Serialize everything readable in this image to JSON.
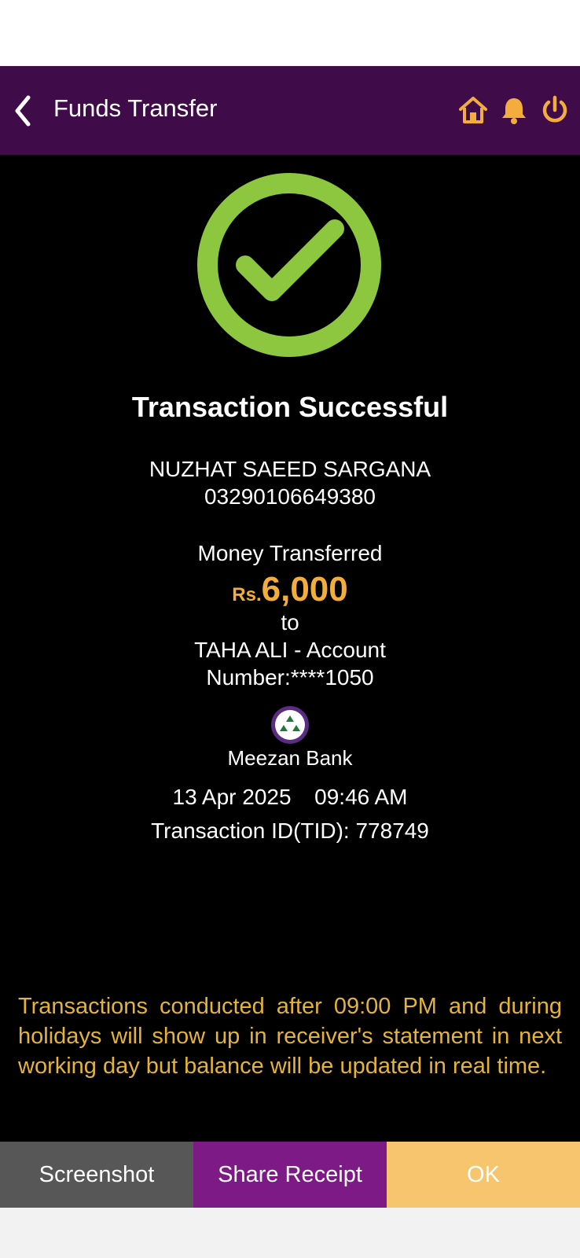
{
  "header": {
    "title": "Funds Transfer",
    "icons": [
      "back-arrow-icon",
      "home-icon",
      "bell-icon",
      "power-icon"
    ],
    "accent_color": "#f2ad3c",
    "background_color": "#3f0b49"
  },
  "receipt": {
    "status_icon": "check-circle-icon",
    "status_color": "#8dc63f",
    "status": "Transaction Successful",
    "sender_name": "NUZHAT SAEED SARGANA",
    "sender_account": "03290106649380",
    "money_label": "Money Transferred",
    "currency": "Rs.",
    "amount": "6,000",
    "to_label": "to",
    "recipient_line1": "TAHA ALI  - Account",
    "recipient_line2": "Number:****1050",
    "bank_logo_text": "MEEZAN BANK",
    "bank_name": "Meezan Bank",
    "date": "13 Apr 2025",
    "time": "09:46 AM",
    "transaction_id": "Transaction ID(TID): 778749"
  },
  "notice": "Transactions conducted after 09:00 PM and during holidays will show up in receiver's statement in next working day but balance will be updated in real time.",
  "footer": {
    "screenshot_label": "Screenshot",
    "share_label": "Share Receipt",
    "ok_label": "OK"
  }
}
